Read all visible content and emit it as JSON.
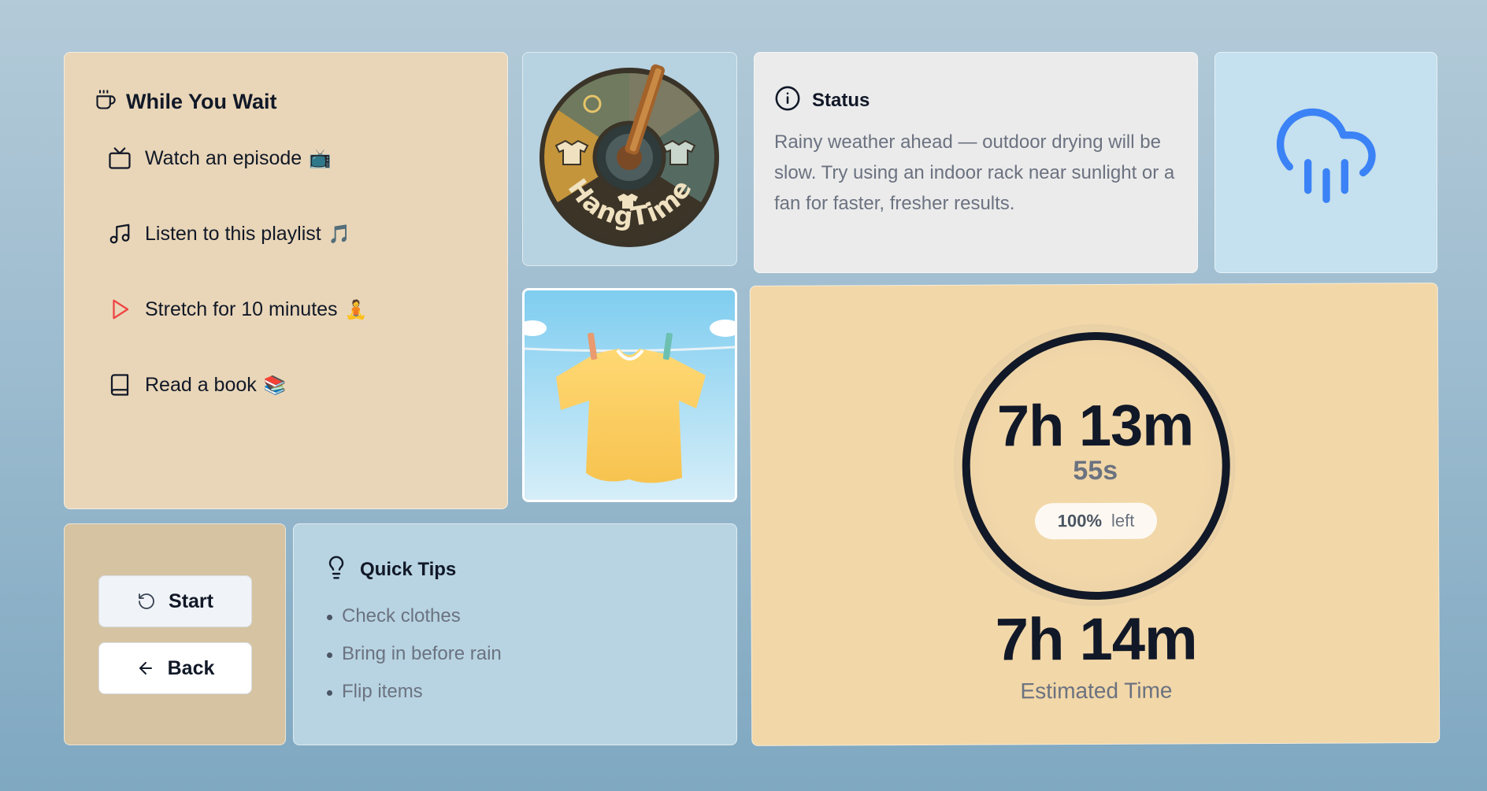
{
  "while_you_wait": {
    "title": "While You Wait",
    "header_icon": "coffee-cup-icon",
    "items": [
      {
        "label": "Watch an episode",
        "emoji": "📺",
        "icon": "tv-icon"
      },
      {
        "label": "Listen to this playlist",
        "emoji": "🎵",
        "icon": "music-note-icon"
      },
      {
        "label": "Stretch for 10 minutes",
        "emoji": "🧘",
        "icon": "play-icon"
      },
      {
        "label": "Read a book",
        "emoji": "📚",
        "icon": "book-icon"
      }
    ]
  },
  "logo": {
    "text": "HangTime"
  },
  "status": {
    "title": "Status",
    "icon": "info-icon",
    "message": "Rainy weather ahead — outdoor drying will be slow. Try using an indoor rack near sunlight or a fan for faster, fresher results."
  },
  "weather": {
    "icon": "rain-cloud-icon",
    "color": "#3b82f6"
  },
  "controls": {
    "start_label": "Start",
    "back_label": "Back"
  },
  "tips": {
    "title": "Quick Tips",
    "icon": "lightbulb-icon",
    "items": [
      "Check clothes",
      "Bring in before rain",
      "Flip items"
    ]
  },
  "timer": {
    "remaining_main": "7h 13m",
    "remaining_seconds": "55s",
    "percent_left": "100%",
    "left_label": "left",
    "percent_value": 100,
    "estimated": "7h 14m",
    "estimated_label": "Estimated Time"
  },
  "colors": {
    "wait_card": "#e9d6b8",
    "timer_card": "#f2d7a8",
    "accent_blue": "#3b82f6",
    "stretch_icon": "#ef4444"
  }
}
